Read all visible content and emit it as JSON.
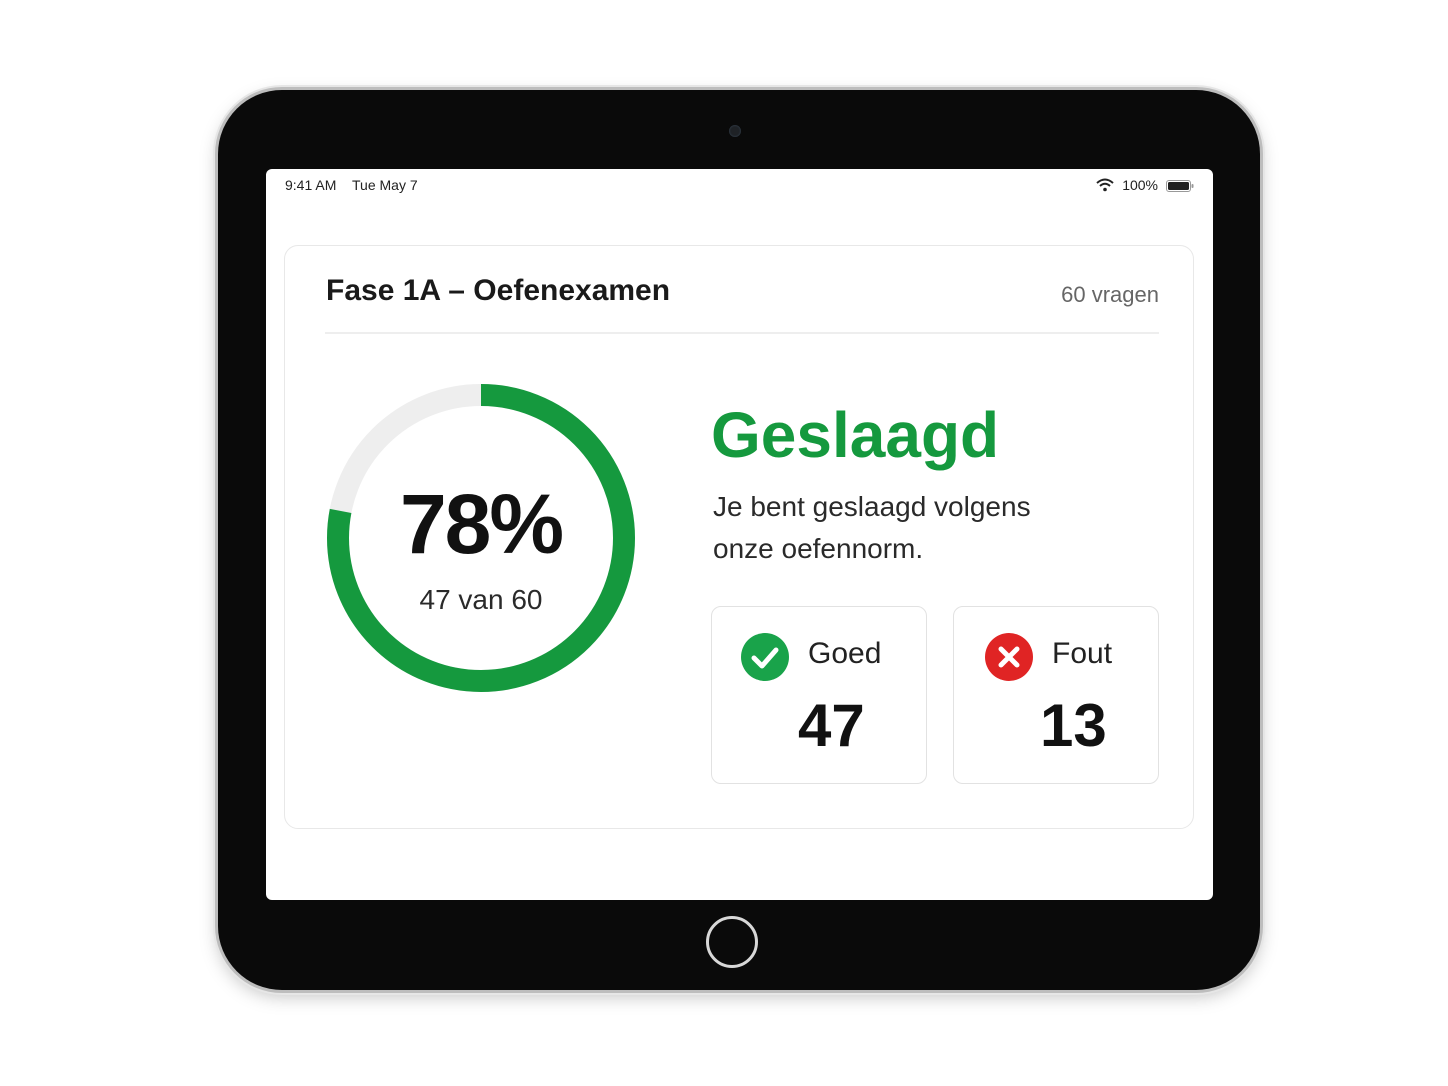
{
  "status_bar": {
    "time": "9:41 AM",
    "date": "Tue May 7",
    "battery": "100%",
    "icons": [
      "wifi-icon",
      "battery-icon"
    ]
  },
  "exam": {
    "title": "Fase 1A – Oefenexamen",
    "questions_label": "60 vragen"
  },
  "score": {
    "percent_label": "78%",
    "percent_value": 78,
    "correct_of_total": "47 van 60",
    "ring_color": "#15993e",
    "ring_track_color": "#eeeeee"
  },
  "result": {
    "title": "Geslaagd",
    "description": "Je bent geslaagd volgens onze oefennorm.",
    "accent_color": "#15993e"
  },
  "stats": {
    "good": {
      "label": "Goed",
      "value": "47",
      "icon": "checkmark-icon",
      "color": "#19a34a"
    },
    "bad": {
      "label": "Fout",
      "value": "13",
      "icon": "cross-icon",
      "color": "#e02424"
    }
  }
}
